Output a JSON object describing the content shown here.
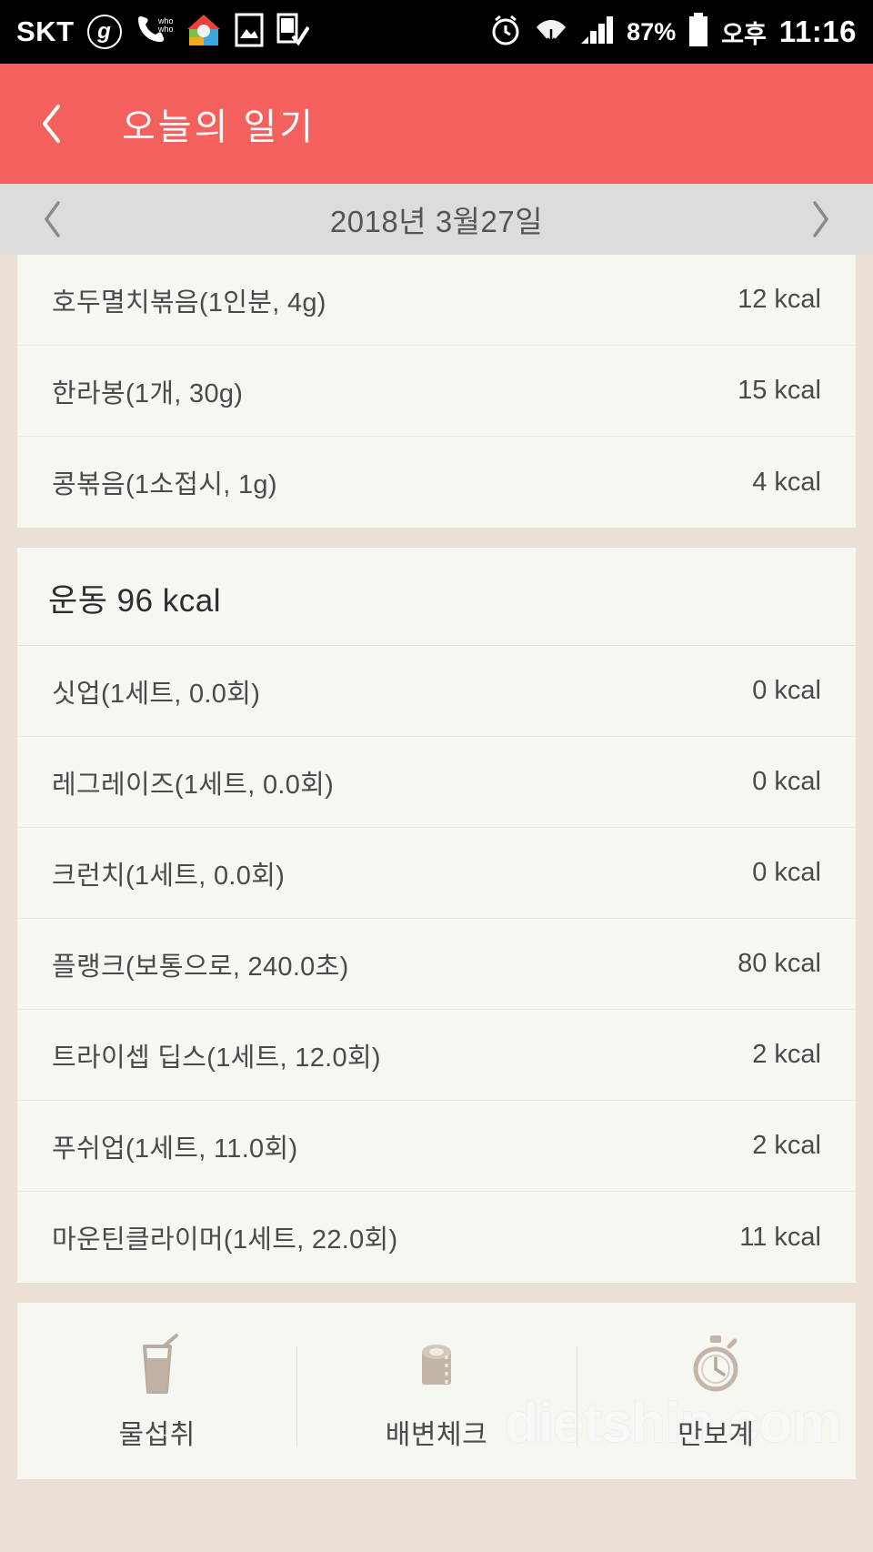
{
  "status_bar": {
    "carrier": "SKT",
    "carrier_badge": "g",
    "icons": [
      "whowho-call-icon",
      "home-app-icon",
      "image-icon",
      "phone-check-icon",
      "alarm-icon",
      "wifi-icon",
      "signal-icon"
    ],
    "battery_percent": "87%",
    "am_pm": "오후",
    "time": "11:16"
  },
  "appbar": {
    "back_icon": "chevron-left-icon",
    "title": "오늘의 일기",
    "accent_color": "#f4605e"
  },
  "datebar": {
    "prev_icon": "chevron-left-icon",
    "next_icon": "chevron-right-icon",
    "date": "2018년 3월27일"
  },
  "food_card": {
    "items": [
      {
        "name": "호두멸치볶음(1인분, 4g)",
        "kcal": "12 kcal"
      },
      {
        "name": "한라봉(1개, 30g)",
        "kcal": "15 kcal"
      },
      {
        "name": "콩볶음(1소접시, 1g)",
        "kcal": "4 kcal"
      }
    ]
  },
  "exercise_card": {
    "section_title": "운동 96 kcal",
    "items": [
      {
        "name": "싯업(1세트, 0.0회)",
        "kcal": "0 kcal"
      },
      {
        "name": "레그레이즈(1세트, 0.0회)",
        "kcal": "0 kcal"
      },
      {
        "name": "크런치(1세트, 0.0회)",
        "kcal": "0 kcal"
      },
      {
        "name": "플랭크(보통으로, 240.0초)",
        "kcal": "80 kcal"
      },
      {
        "name": "트라이셉 딥스(1세트, 12.0회)",
        "kcal": "2 kcal"
      },
      {
        "name": "푸쉬업(1세트, 11.0회)",
        "kcal": "2 kcal"
      },
      {
        "name": "마운틴클라이머(1세트, 22.0회)",
        "kcal": "11 kcal"
      }
    ]
  },
  "quickbar": {
    "items": [
      {
        "label": "물섭취",
        "icon": "water-glass-icon"
      },
      {
        "label": "배변체크",
        "icon": "toilet-roll-icon"
      },
      {
        "label": "만보계",
        "icon": "stopwatch-icon"
      }
    ],
    "watermark": "dietshin.com"
  }
}
